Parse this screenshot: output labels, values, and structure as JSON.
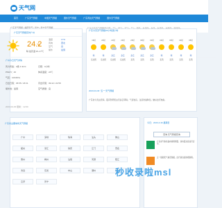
{
  "site": {
    "logo_text": "天气网"
  },
  "nav": {
    "items": [
      "首页",
      "广东天气预报",
      "中国天气预报",
      "国外天气预报",
      "广东周边天气预报",
      "国外天气预报"
    ]
  },
  "breadcrumb": "广东天气预报 / 揭阳天气 / 普宁 / 普宁天气预报",
  "current": {
    "title": "广东天气预报实时广州",
    "temperature": "24.2",
    "unit": "℃",
    "desc": "晴 最高温 26~17℃",
    "stats": [
      {
        "k": "温度",
        "v": "17%"
      },
      {
        "k": "风向",
        "v": "西北"
      },
      {
        "k": "空气",
        "v": "良"
      },
      {
        "k": "紫外",
        "v": "最弱"
      }
    ],
    "today_title": "广州今日天气详情",
    "details": [
      [
        "风力风速：2级 4.4m/s",
        "日照：0小时"
      ],
      [
        "PM2.5：46",
        "体感温度：24℃"
      ],
      [
        "气压：1004hPa",
        ""
      ],
      [
        "日出日落：05:55 / 18:31",
        "月出月落：09:42 / 22:58"
      ],
      [
        "紫外线：最弱",
        "空气质量：良"
      ]
    ],
    "update": "2023-04-30 更新：12:00"
  },
  "forecast": {
    "title": "广东今天天气预报24小时逐小时",
    "subtitle": "广东今天天气预报24小时，7℃，21℃，17℃，7℃，北风，东北风，东风，东北风，东南风，西北风。",
    "hours": [
      {
        "time": "19时",
        "icon": "sun-icon",
        "temp": "晴",
        "wind": "东北风"
      },
      {
        "time": "20时",
        "icon": "sun-icon",
        "temp": "晴",
        "wind": "东北风"
      },
      {
        "time": "21时",
        "icon": "partly-cloudy-icon",
        "temp": "多云",
        "wind": "东北风"
      },
      {
        "time": "22时",
        "icon": "partly-cloudy-icon",
        "temp": "多云",
        "wind": "东北风"
      },
      {
        "time": "23时",
        "icon": "partly-cloudy-icon",
        "temp": "多云",
        "wind": "东风"
      },
      {
        "time": "00时",
        "icon": "partly-cloudy-icon",
        "temp": "多云",
        "wind": "东风"
      },
      {
        "time": "01时",
        "icon": "partly-cloudy-icon",
        "temp": "多云",
        "wind": "东风"
      },
      {
        "time": "02时",
        "icon": "sun-icon",
        "temp": "晴",
        "wind": "东风"
      },
      {
        "time": "03时",
        "icon": "sun-icon",
        "temp": "晴",
        "wind": "东风"
      },
      {
        "time": "04时",
        "icon": "sun-icon",
        "temp": "晴",
        "wind": "东风"
      },
      {
        "time": "05时",
        "icon": "sun-icon",
        "temp": "晴",
        "wind": "东风"
      }
    ],
    "foot": "2023-04-30 “五一”天气预报",
    "note": "广东省今天白天晴，夜间到明天白天多云转晴；气温较高，注意防暑降温，做好出行准备。"
  },
  "cities": {
    "title": "广东省主要城市天气预报",
    "items": [
      "广州",
      "深圳",
      "珠海",
      "汕头",
      "佛山",
      "韶关",
      "湛江",
      "肇庆",
      "江门",
      "茂名",
      "惠州",
      "梅州",
      "汕尾",
      "河源",
      "阳江",
      "清远",
      "东莞",
      "中山",
      "潮州",
      "揭阳",
      "云浮",
      "普宁"
    ]
  },
  "side": {
    "title": "今日：2023-4-30 星期日",
    "search": "查询 天气预报查询",
    "news": [
      {
        "text": "广东省气象台发布暴雨预警，请市民注意出行安全。",
        "color": "green"
      },
      {
        "text": "五一假期天气情况预报，出行请注意防晒防雨。",
        "color": "orange"
      }
    ]
  },
  "watermark": "秒收录啦msl"
}
